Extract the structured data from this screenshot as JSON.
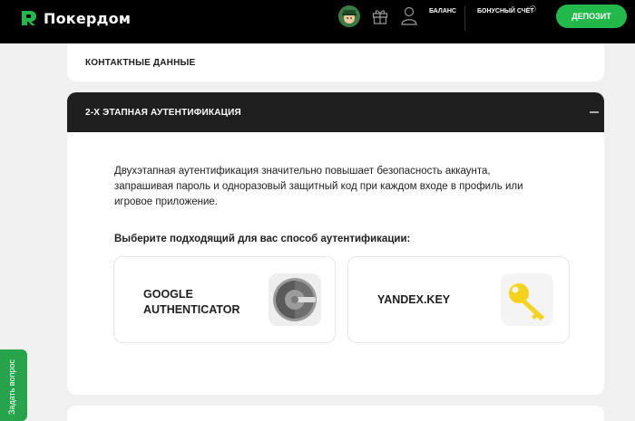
{
  "header": {
    "brand": "Покердом",
    "balance_label": "БАЛАНС",
    "bonus_label": "БОНУСНЫЙ СЧЁТ",
    "help_mark": "?",
    "deposit_label": "ДЕПОЗИТ",
    "icons": [
      "pokerdom-logo-icon",
      "avatar",
      "gift-icon",
      "user-icon"
    ]
  },
  "contacts": {
    "title": "КОНТАКТНЫЕ ДАННЫЕ"
  },
  "twofa": {
    "title": "2-Х ЭТАПНАЯ АУТЕНТИФИКАЦИЯ",
    "collapse_icon": "minus-icon",
    "description": "Двухэтапная аутентификация значительно повышает безопасность аккаунта, запрашивая пароль и одноразовый защитный код при каждом входе в профиль или игровое приложение.",
    "choose_label": "Выберите подходящий для вас способ аутентификации:",
    "methods": [
      {
        "name": "GOOGLE AUTHENTICATOR",
        "icon": "google-authenticator-icon"
      },
      {
        "name": "YANDEX.KEY",
        "icon": "key-icon"
      }
    ]
  },
  "ask_question": "Задать вопрос",
  "colors": {
    "accent": "#22b84a",
    "header_bg": "#000000",
    "section_head_bg": "#1e1e1e",
    "page_bg": "#f0f0f0",
    "key_yellow": "#f5d31c"
  }
}
